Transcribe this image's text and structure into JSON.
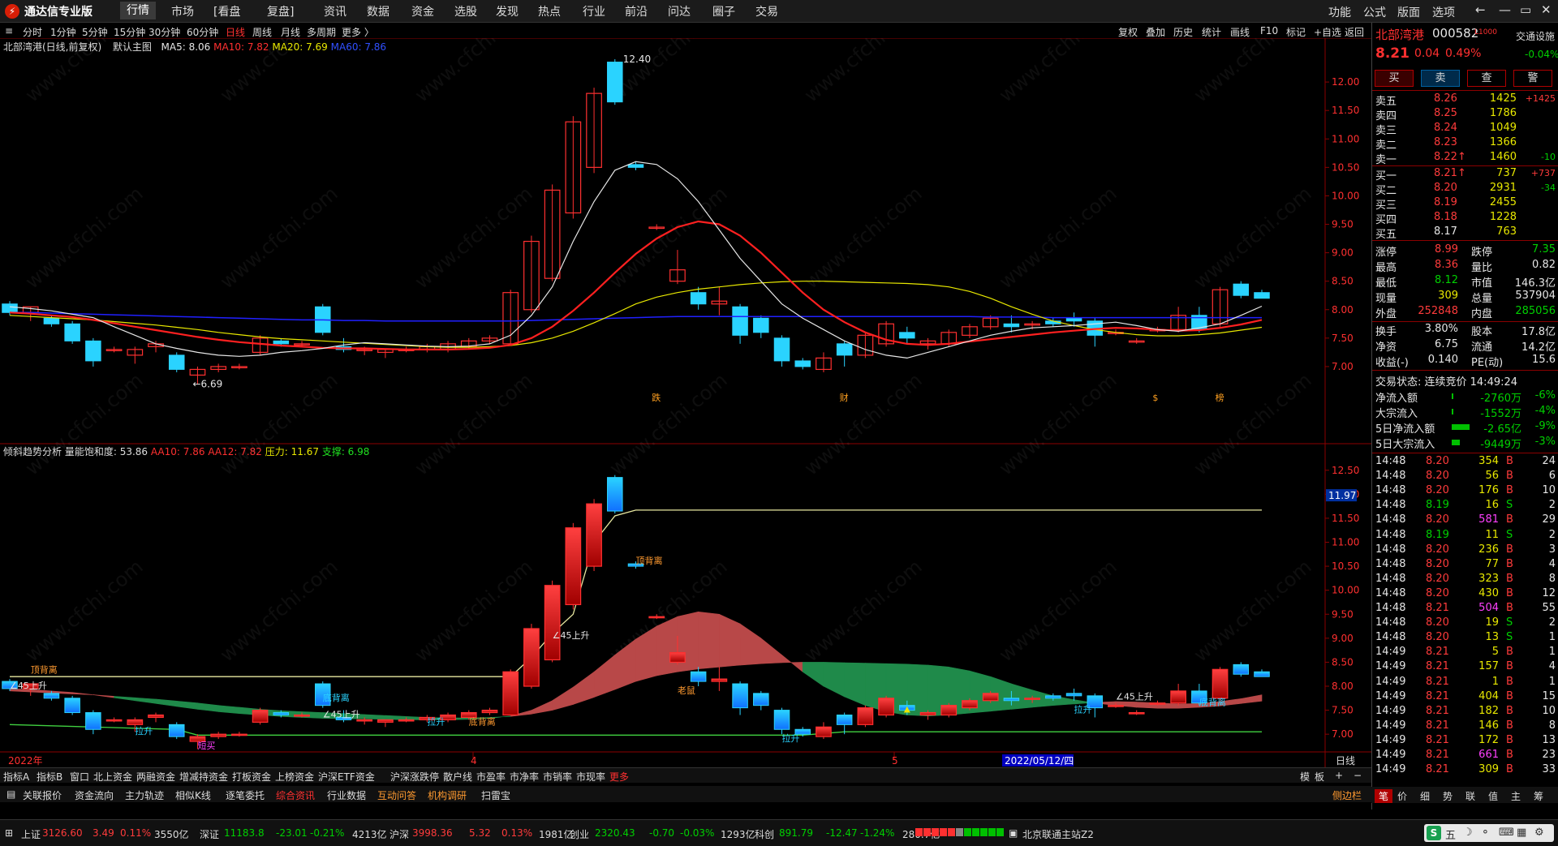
{
  "app": {
    "logo_text": "通达信专业版",
    "logo_glyph": "⚡"
  },
  "menu": [
    "行情",
    "市场",
    "[看盘",
    "复盘]",
    "资讯",
    "数据",
    "资金",
    "选股",
    "发现",
    "热点",
    "行业",
    "前沿",
    "问达",
    "圈子",
    "交易"
  ],
  "menu_right": [
    "功能",
    "公式",
    "版面",
    "选项"
  ],
  "window_buttons": [
    "←",
    "—",
    "▭",
    "✕"
  ],
  "periods": [
    "分时",
    "1分钟",
    "5分钟",
    "15分钟",
    "30分钟",
    "60分钟",
    "日线",
    "周线",
    "月线",
    "多周期",
    "更多 〉"
  ],
  "selected_period": "日线",
  "chart_tools": [
    "复权",
    "叠加",
    "历史",
    "统计",
    "画线",
    "F10",
    "标记",
    "+自选",
    "返回"
  ],
  "main_info": {
    "title": "北部湾港(日线,前复权)",
    "template": "默认主图",
    "ma5": "MA5: 8.06",
    "ma10": "MA10: 7.82",
    "ma20": "MA20: 7.69",
    "ma60": "MA60: 7.86"
  },
  "sub_info": {
    "title": "倾斜趋势分析",
    "f1": "量能饱和度: 53.86",
    "f2": "AA10: 7.86",
    "f3": "AA12: 7.82",
    "f4": "压力: 11.67",
    "f5": "支撑: 6.98"
  },
  "main_axis_ticks": [
    "12.00",
    "11.50",
    "11.00",
    "10.50",
    "10.00",
    "9.50",
    "9.00",
    "8.50",
    "8.00",
    "7.50",
    "7.00"
  ],
  "sub_axis_ticks": [
    "12.50",
    "12.00",
    "11.50",
    "11.00",
    "10.50",
    "10.00",
    "9.50",
    "9.00",
    "8.50",
    "8.00",
    "7.50",
    "7.00"
  ],
  "sub_axis_marker": "11.97",
  "chart_labels": {
    "high": "12.40",
    "low": "6.69",
    "mark1": "跌",
    "mark2": "财",
    "mark3": "$",
    "mark4": "榜",
    "dbl1": "顶背离",
    "dbl2": "顶背离",
    "dbl3": "底背离",
    "dbl4": "底背离",
    "dbl5": "底背离",
    "rise1": "∠45上升",
    "rise2": "∠45上升",
    "rise3": "∠45上升",
    "rise4": "∠45上升",
    "pull1": "拉升",
    "pull2": "拉升",
    "pull3": "拉升",
    "pull4": "拉升",
    "old": "老鼠",
    "short": "短买",
    "xaxis_year": "2022年",
    "xaxis_4": "4",
    "xaxis_5": "5",
    "xaxis_date": "2022/05/12/四",
    "xaxis_period": "日线"
  },
  "chart_data": [
    {
      "type": "candlestick",
      "title": "北部湾港(日线,前复权)",
      "ylim": [
        6.5,
        12.7
      ],
      "candles": [
        [
          8.1,
          8.15,
          7.9,
          7.95
        ],
        [
          7.95,
          8.05,
          7.8,
          8.05
        ],
        [
          7.85,
          7.9,
          7.7,
          7.75
        ],
        [
          7.75,
          7.8,
          7.4,
          7.45
        ],
        [
          7.45,
          7.5,
          7.0,
          7.1
        ],
        [
          7.3,
          7.35,
          7.25,
          7.3
        ],
        [
          7.2,
          7.35,
          7.05,
          7.3
        ],
        [
          7.35,
          7.45,
          7.25,
          7.4
        ],
        [
          7.2,
          7.25,
          6.9,
          6.95
        ],
        [
          6.85,
          7.0,
          6.69,
          6.95
        ],
        [
          6.95,
          7.05,
          6.9,
          7.0
        ],
        [
          7.0,
          7.05,
          6.95,
          7.0
        ],
        [
          7.25,
          7.55,
          7.2,
          7.5
        ],
        [
          7.45,
          7.5,
          7.35,
          7.4
        ],
        [
          7.4,
          7.45,
          7.35,
          7.4
        ],
        [
          8.05,
          8.1,
          7.55,
          7.6
        ],
        [
          7.35,
          7.5,
          7.25,
          7.3
        ],
        [
          7.3,
          7.35,
          7.2,
          7.3
        ],
        [
          7.25,
          7.3,
          7.15,
          7.3
        ],
        [
          7.3,
          7.35,
          7.25,
          7.3
        ],
        [
          7.3,
          7.4,
          7.25,
          7.35
        ],
        [
          7.3,
          7.45,
          7.25,
          7.4
        ],
        [
          7.35,
          7.5,
          7.3,
          7.45
        ],
        [
          7.45,
          7.55,
          7.4,
          7.5
        ],
        [
          7.4,
          8.35,
          7.4,
          8.3
        ],
        [
          8.0,
          9.3,
          7.95,
          9.2
        ],
        [
          8.55,
          10.2,
          8.5,
          10.1
        ],
        [
          9.7,
          11.4,
          9.6,
          11.3
        ],
        [
          10.5,
          11.9,
          10.4,
          11.8
        ],
        [
          12.35,
          12.4,
          11.6,
          11.65
        ],
        [
          10.55,
          10.6,
          10.45,
          10.5
        ],
        [
          9.45,
          9.5,
          9.4,
          9.45
        ],
        [
          8.5,
          9.05,
          8.45,
          8.7
        ],
        [
          8.3,
          8.4,
          8.0,
          8.1
        ],
        [
          8.1,
          8.4,
          7.9,
          8.15
        ],
        [
          8.05,
          8.1,
          7.4,
          7.55
        ],
        [
          7.85,
          7.9,
          7.5,
          7.6
        ],
        [
          7.5,
          7.55,
          7.0,
          7.1
        ],
        [
          7.1,
          7.15,
          6.95,
          7.0
        ],
        [
          6.95,
          7.25,
          6.9,
          7.15
        ],
        [
          7.4,
          7.45,
          7.0,
          7.2
        ],
        [
          7.2,
          7.6,
          7.15,
          7.55
        ],
        [
          7.4,
          7.8,
          7.35,
          7.75
        ],
        [
          7.6,
          7.7,
          7.4,
          7.5
        ],
        [
          7.4,
          7.5,
          7.3,
          7.45
        ],
        [
          7.4,
          7.65,
          7.35,
          7.6
        ],
        [
          7.55,
          7.75,
          7.5,
          7.7
        ],
        [
          7.7,
          7.9,
          7.65,
          7.85
        ],
        [
          7.75,
          7.9,
          7.6,
          7.7
        ],
        [
          7.75,
          7.8,
          7.65,
          7.75
        ],
        [
          7.8,
          7.85,
          7.7,
          7.75
        ],
        [
          7.85,
          7.95,
          7.7,
          7.8
        ],
        [
          7.8,
          7.85,
          7.35,
          7.55
        ],
        [
          7.6,
          7.65,
          7.55,
          7.6
        ],
        [
          7.45,
          7.5,
          7.4,
          7.45
        ],
        [
          7.65,
          7.7,
          7.6,
          7.65
        ],
        [
          7.65,
          8.05,
          7.6,
          7.9
        ],
        [
          7.9,
          8.05,
          7.6,
          7.65
        ],
        [
          7.75,
          8.4,
          7.7,
          8.35
        ],
        [
          8.45,
          8.5,
          8.2,
          8.25
        ],
        [
          8.3,
          8.35,
          8.2,
          8.2
        ]
      ],
      "ma5": [
        8.05,
        8.02,
        7.98,
        7.92,
        7.86,
        7.7,
        7.55,
        7.4,
        7.32,
        7.25,
        7.2,
        7.18,
        7.2,
        7.25,
        7.28,
        7.32,
        7.38,
        7.42,
        7.4,
        7.38,
        7.36,
        7.35,
        7.36,
        7.4,
        7.55,
        7.9,
        8.4,
        9.2,
        9.9,
        10.45,
        10.6,
        10.55,
        10.3,
        9.9,
        9.4,
        8.9,
        8.5,
        8.1,
        7.85,
        7.65,
        7.45,
        7.3,
        7.2,
        7.15,
        7.25,
        7.35,
        7.45,
        7.55,
        7.62,
        7.68,
        7.7,
        7.72,
        7.75,
        7.78,
        7.72,
        7.65,
        7.62,
        7.68,
        7.75,
        7.9,
        8.06
      ],
      "ma10": [
        7.95,
        7.93,
        7.9,
        7.87,
        7.82,
        7.76,
        7.7,
        7.64,
        7.58,
        7.52,
        7.47,
        7.43,
        7.4,
        7.37,
        7.35,
        7.33,
        7.32,
        7.32,
        7.31,
        7.3,
        7.3,
        7.3,
        7.31,
        7.33,
        7.38,
        7.5,
        7.7,
        7.98,
        8.3,
        8.65,
        8.98,
        9.25,
        9.45,
        9.55,
        9.5,
        9.3,
        9.0,
        8.65,
        8.3,
        8.0,
        7.78,
        7.6,
        7.47,
        7.4,
        7.38,
        7.4,
        7.44,
        7.48,
        7.52,
        7.56,
        7.6,
        7.63,
        7.66,
        7.68,
        7.67,
        7.65,
        7.63,
        7.64,
        7.68,
        7.74,
        7.82
      ],
      "ma20": [
        7.9,
        7.88,
        7.86,
        7.84,
        7.82,
        7.79,
        7.76,
        7.73,
        7.69,
        7.65,
        7.6,
        7.56,
        7.52,
        7.49,
        7.47,
        7.45,
        7.43,
        7.41,
        7.39,
        7.37,
        7.35,
        7.34,
        7.34,
        7.35,
        7.37,
        7.42,
        7.5,
        7.62,
        7.77,
        7.93,
        8.1,
        8.22,
        8.3,
        8.36,
        8.4,
        8.44,
        8.47,
        8.49,
        8.5,
        8.5,
        8.49,
        8.48,
        8.47,
        8.46,
        8.44,
        8.4,
        8.32,
        8.2,
        8.05,
        7.92,
        7.8,
        7.72,
        7.65,
        7.6,
        7.56,
        7.54,
        7.54,
        7.56,
        7.59,
        7.64,
        7.69
      ],
      "ma60": [
        7.95,
        7.95,
        7.94,
        7.93,
        7.92,
        7.91,
        7.9,
        7.89,
        7.88,
        7.87,
        7.86,
        7.85,
        7.84,
        7.83,
        7.82,
        7.82,
        7.81,
        7.81,
        7.8,
        7.8,
        7.8,
        7.8,
        7.8,
        7.8,
        7.8,
        7.81,
        7.82,
        7.83,
        7.84,
        7.85,
        7.86,
        7.87,
        7.88,
        7.88,
        7.88,
        7.88,
        7.88,
        7.88,
        7.88,
        7.88,
        7.88,
        7.88,
        7.88,
        7.88,
        7.88,
        7.88,
        7.88,
        7.87,
        7.87,
        7.87,
        7.86,
        7.86,
        7.86,
        7.86,
        7.86,
        7.86,
        7.86,
        7.86,
        7.86,
        7.86,
        7.86
      ]
    },
    {
      "type": "candlestick",
      "title": "倾斜趋势分析",
      "ylim": [
        6.8,
        12.8
      ],
      "pressure": [
        [
          0,
          8.2
        ],
        [
          4,
          8.2
        ],
        [
          24,
          8.2
        ],
        [
          25,
          8.6
        ],
        [
          26,
          9.1
        ],
        [
          27,
          9.5
        ],
        [
          28,
          11.0
        ],
        [
          29,
          11.55
        ],
        [
          30,
          11.67
        ],
        [
          60,
          11.67
        ]
      ],
      "support": [
        [
          0,
          7.2
        ],
        [
          8,
          7.1
        ],
        [
          9,
          6.98
        ],
        [
          38,
          6.98
        ],
        [
          40,
          7.05
        ],
        [
          60,
          7.05
        ]
      ]
    }
  ],
  "quote": {
    "name": "北部湾港",
    "code": "000582",
    "badge": "L1000",
    "link_label": "交通设施",
    "price": "8.21",
    "change": "0.04",
    "pct": "0.49%",
    "sector_pct": "-0.04%",
    "buttons": [
      "买",
      "卖",
      "查",
      "警"
    ]
  },
  "asks": [
    {
      "label": "卖五",
      "price": "8.26",
      "vol": "1425",
      "delta": "+1425"
    },
    {
      "label": "卖四",
      "price": "8.25",
      "vol": "1786",
      "delta": ""
    },
    {
      "label": "卖三",
      "price": "8.24",
      "vol": "1049",
      "delta": ""
    },
    {
      "label": "卖二",
      "price": "8.23",
      "vol": "1366",
      "delta": ""
    },
    {
      "label": "卖一",
      "price": "8.22↑",
      "vol": "1460",
      "delta": "-10"
    }
  ],
  "bids": [
    {
      "label": "买一",
      "price": "8.21↑",
      "vol": "737",
      "delta": "+737"
    },
    {
      "label": "买二",
      "price": "8.20",
      "vol": "2931",
      "delta": "-34"
    },
    {
      "label": "买三",
      "price": "8.19",
      "vol": "2455",
      "delta": ""
    },
    {
      "label": "买四",
      "price": "8.18",
      "vol": "1228",
      "delta": ""
    },
    {
      "label": "买五",
      "price": "8.17",
      "vol": "763",
      "delta": ""
    }
  ],
  "stats": [
    {
      "l1": "涨停",
      "v1": "8.99",
      "l2": "跌停",
      "v2": "7.35"
    },
    {
      "l1": "最高",
      "v1": "8.36",
      "l2": "量比",
      "v2": "0.82"
    },
    {
      "l1": "最低",
      "v1": "8.12",
      "l2": "市值",
      "v2": "146.3亿"
    },
    {
      "l1": "现量",
      "v1": "309",
      "l2": "总量",
      "v2": "537904"
    },
    {
      "l1": "外盘",
      "v1": "252848",
      "l2": "内盘",
      "v2": "285056"
    }
  ],
  "stats2": [
    {
      "l1": "换手",
      "v1": "3.80%",
      "l2": "股本",
      "v2": "17.8亿"
    },
    {
      "l1": "净资",
      "v1": "6.75",
      "l2": "流通",
      "v2": "14.2亿"
    },
    {
      "l1": "收益(-)",
      "v1": "0.140",
      "l2": "PE(动)",
      "v2": "15.6"
    }
  ],
  "trade_status": "交易状态: 连续竞价 14:49:24",
  "flows": [
    {
      "label": "净流入额",
      "value": "-2760万",
      "pct": "-6%",
      "bar": 0.02
    },
    {
      "label": "大宗流入",
      "value": "-1552万",
      "pct": "-4%",
      "bar": 0.02
    },
    {
      "label": "5日净流入额",
      "value": "-2.65亿",
      "pct": "-9%",
      "bar": 0.55
    },
    {
      "label": "5日大宗流入",
      "value": "-9449万",
      "pct": "-3%",
      "bar": 0.25
    }
  ],
  "ticks": [
    {
      "t": "14:48",
      "p": "8.20",
      "v": "354",
      "s": "B",
      "n": "24"
    },
    {
      "t": "14:48",
      "p": "8.20",
      "v": "56",
      "s": "B",
      "n": "6"
    },
    {
      "t": "14:48",
      "p": "8.20",
      "v": "176",
      "s": "B",
      "n": "10"
    },
    {
      "t": "14:48",
      "p": "8.19",
      "v": "16",
      "s": "S",
      "n": "2"
    },
    {
      "t": "14:48",
      "p": "8.20",
      "v": "581",
      "s": "B",
      "n": "29"
    },
    {
      "t": "14:48",
      "p": "8.19",
      "v": "11",
      "s": "S",
      "n": "2"
    },
    {
      "t": "14:48",
      "p": "8.20",
      "v": "236",
      "s": "B",
      "n": "3"
    },
    {
      "t": "14:48",
      "p": "8.20",
      "v": "77",
      "s": "B",
      "n": "4"
    },
    {
      "t": "14:48",
      "p": "8.20",
      "v": "323",
      "s": "B",
      "n": "8"
    },
    {
      "t": "14:48",
      "p": "8.20",
      "v": "430",
      "s": "B",
      "n": "12"
    },
    {
      "t": "14:48",
      "p": "8.21",
      "v": "504",
      "s": "B",
      "n": "55"
    },
    {
      "t": "14:48",
      "p": "8.20",
      "v": "19",
      "s": "S",
      "n": "2"
    },
    {
      "t": "14:48",
      "p": "8.20",
      "v": "13",
      "s": "S",
      "n": "1"
    },
    {
      "t": "14:49",
      "p": "8.21",
      "v": "5",
      "s": "B",
      "n": "1"
    },
    {
      "t": "14:49",
      "p": "8.21",
      "v": "157",
      "s": "B",
      "n": "4"
    },
    {
      "t": "14:49",
      "p": "8.21",
      "v": "1",
      "s": "B",
      "n": "1"
    },
    {
      "t": "14:49",
      "p": "8.21",
      "v": "404",
      "s": "B",
      "n": "15"
    },
    {
      "t": "14:49",
      "p": "8.21",
      "v": "182",
      "s": "B",
      "n": "10"
    },
    {
      "t": "14:49",
      "p": "8.21",
      "v": "146",
      "s": "B",
      "n": "8"
    },
    {
      "t": "14:49",
      "p": "8.21",
      "v": "172",
      "s": "B",
      "n": "13"
    },
    {
      "t": "14:49",
      "p": "8.21",
      "v": "661",
      "s": "B",
      "n": "23"
    },
    {
      "t": "14:49",
      "p": "8.21",
      "v": "309",
      "s": "B",
      "n": "33"
    }
  ],
  "indicator_tabs": [
    "指标A",
    "指标B",
    "窗口",
    "北上资金",
    "两融资金",
    "增减持资金",
    "打板资金",
    "上榜资金",
    "沪深ETF资金",
    "沪深涨跌停",
    "散户线",
    "市盈率",
    "市净率",
    "市销率",
    "市现率",
    "更多"
  ],
  "indicator_right": [
    "模",
    "板",
    "+",
    "−"
  ],
  "info_tabs": [
    "关联报价",
    "资金流向",
    "主力轨迹",
    "相似K线",
    "逐笔委托",
    "综合资讯",
    "行业数据",
    "互动问答",
    "机构调研",
    "扫雷宝"
  ],
  "info_right": "侧边栏",
  "rp_tabs": [
    "笔",
    "价",
    "细",
    "势",
    "联",
    "值",
    "主",
    "筹"
  ],
  "status_items": [
    {
      "name": "上证",
      "val": "3126.60",
      "chg": "3.49",
      "pct": "0.11%",
      "amt": "3550亿"
    },
    {
      "name": "深证",
      "val": "11183.8",
      "chg": "-23.01",
      "pct": "-0.21%",
      "amt": "4213亿"
    },
    {
      "name": "沪深",
      "val": "3998.36",
      "chg": "5.32",
      "pct": "0.13%",
      "amt": "1981亿"
    },
    {
      "name": "创业",
      "val": "2320.43",
      "chg": "-0.70",
      "pct": "-0.03%",
      "amt": "1293亿"
    },
    {
      "name": "科创",
      "val": "891.79",
      "chg": "-12.47",
      "pct": "-1.24%",
      "amt": "280.7亿"
    }
  ],
  "server": "北京联通主站Z2",
  "ime": [
    "五",
    "☽",
    "⚬",
    "⌨",
    "▦",
    "⚙"
  ],
  "watermark": "www.cfchi.com",
  "colors": {
    "up": "#ff3b3b",
    "down": "#2ad3ff",
    "ma5": "#e6e6e6",
    "ma10": "#ff2020",
    "ma20": "#e8e800",
    "ma60": "#2020ff"
  }
}
